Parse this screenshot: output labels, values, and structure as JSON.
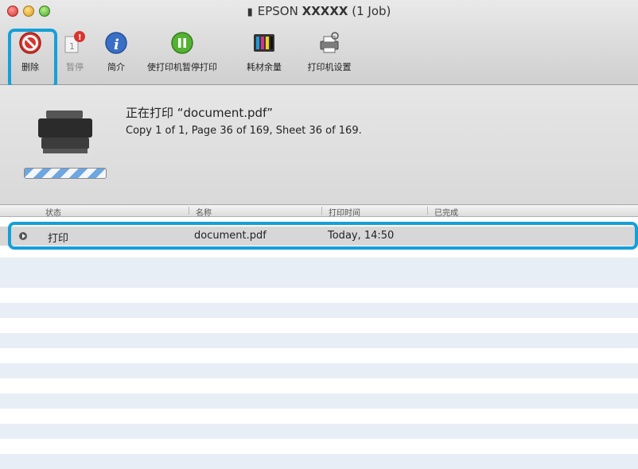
{
  "window": {
    "title_brand": "EPSON",
    "title_model": "XXXXX",
    "title_suffix": "(1 Job)"
  },
  "toolbar": {
    "delete_label": "删除",
    "pause_label": "暂停",
    "info_label": "简介",
    "pause_printer_label": "使打印机暂停打印",
    "supply_levels_label": "耗材余量",
    "printer_setup_label": "打印机设置",
    "pause_badge": "!",
    "pause_page_number": "1"
  },
  "job_info": {
    "title": "正在打印 “document.pdf”",
    "detail": "Copy 1 of 1, Page 36 of 169, Sheet 36 of 169."
  },
  "columns": [
    "状态",
    "名称",
    "打印时间",
    "已完成"
  ],
  "jobs": [
    {
      "status": "打印",
      "name": "document.pdf",
      "time": "Today, 14:50",
      "completed": ""
    }
  ],
  "colors": {
    "highlight": "#16a0d8",
    "stripe": "#e8eef6",
    "selected_row": "#d7d7d7"
  },
  "icons": [
    "printer-icon",
    "delete-icon",
    "pause-icon",
    "info-icon",
    "pause-printer-icon",
    "supply-levels-icon",
    "printer-setup-icon",
    "play-icon"
  ]
}
